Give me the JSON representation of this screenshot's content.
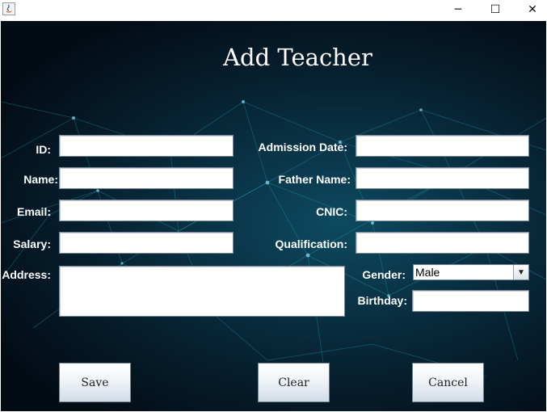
{
  "window": {
    "controls": {
      "minimize": "─",
      "maximize": "☐",
      "close": "✕"
    }
  },
  "form": {
    "title": "Add Teacher",
    "labels": {
      "id": "ID:",
      "name": "Name:",
      "email": "Email:",
      "salary": "Salary:",
      "address": "Address:",
      "admission_date": "Admission Date:",
      "father_name": "Father Name:",
      "cnic": "CNIC:",
      "qualification": "Qualification:",
      "gender": "Gender:",
      "birthday": "Birthday:"
    },
    "values": {
      "id": "",
      "name": "",
      "email": "",
      "salary": "",
      "address": "",
      "admission_date": "",
      "father_name": "",
      "cnic": "",
      "qualification": "",
      "birthday": ""
    },
    "gender": {
      "selected": "Male",
      "arrow": "▼"
    }
  },
  "buttons": {
    "save": "Save",
    "clear": "Clear",
    "cancel": "Cancel"
  },
  "colors": {
    "background": "#061e2d",
    "network_lines": "#2bb3c9",
    "text": "#ffffff"
  }
}
